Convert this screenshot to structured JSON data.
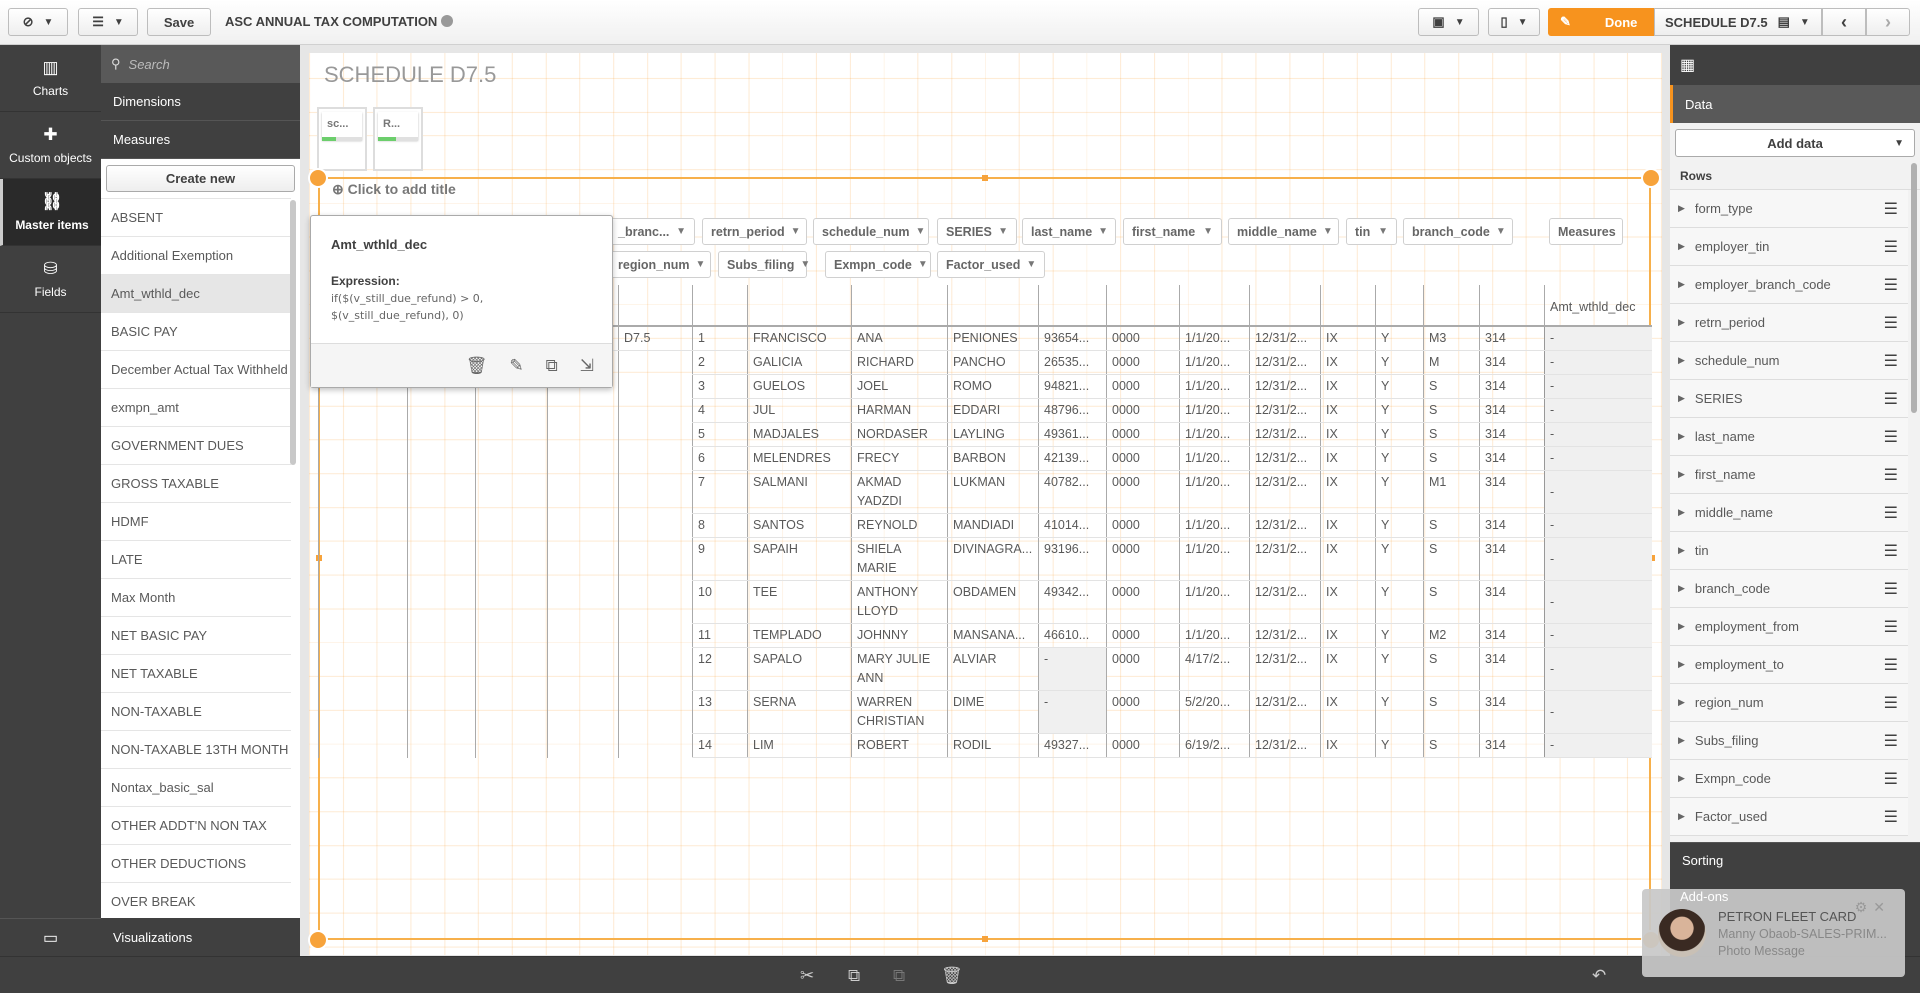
{
  "topbar": {
    "save_label": "Save",
    "app_title": "ASC ANNUAL TAX COMPUTATION",
    "done_label": "Done",
    "sheet_name": "SCHEDULE D7.5"
  },
  "left_nav": {
    "items": [
      {
        "label": "Charts",
        "icon": "bar-chart-icon"
      },
      {
        "label": "Custom objects",
        "icon": "puzzle-icon"
      },
      {
        "label": "Master items",
        "icon": "link-icon",
        "active": true
      },
      {
        "label": "Fields",
        "icon": "database-icon"
      }
    ]
  },
  "assets": {
    "search_placeholder": "Search",
    "dimensions_label": "Dimensions",
    "measures_label": "Measures",
    "create_new_label": "Create new",
    "measures": [
      "ABSENT",
      "Additional Exemption",
      "Amt_wthld_dec",
      "BASIC PAY",
      "December Actual Tax Withheld",
      "exmpn_amt",
      "GOVERNMENT DUES",
      "GROSS TAXABLE",
      "HDMF",
      "LATE",
      "Max Month",
      "NET BASIC PAY",
      "NET TAXABLE",
      "NON-TAXABLE",
      "NON-TAXABLE 13TH MONTH",
      "Nontax_basic_sal",
      "OTHER ADDT'N NON TAX",
      "OTHER DEDUCTIONS",
      "OVER BREAK"
    ],
    "selected_measure": "Amt_wthld_dec",
    "visualizations_label": "Visualizations"
  },
  "sheet": {
    "title": "SCHEDULE D7.5",
    "thumbnails": [
      {
        "label": "sc...",
        "progress": 0.35
      },
      {
        "label": "R...",
        "progress": 0.45
      }
    ],
    "add_title_label": "Click to add title"
  },
  "table": {
    "filter_chips_row1": [
      "_branc...",
      "retrn_period",
      "schedule_num",
      "SERIES",
      "last_name",
      "first_name",
      "middle_name",
      "tin",
      "branch_code"
    ],
    "filter_chips_row2": [
      "region_num",
      "Subs_filing",
      "Exmpn_code",
      "Factor_used"
    ],
    "measures_chip": "Measures",
    "measure_header": "Amt_wthld_dec",
    "rows": [
      [
        "D7.5",
        "1",
        "FRANCISCO",
        "ANA",
        "PENIONES",
        "93654...",
        "0000",
        "1/1/20...",
        "12/31/2...",
        "IX",
        "Y",
        "M3",
        "314",
        "-"
      ],
      [
        "",
        "2",
        "GALICIA",
        "RICHARD",
        "PANCHO",
        "26535...",
        "0000",
        "1/1/20...",
        "12/31/2...",
        "IX",
        "Y",
        "M",
        "314",
        "-"
      ],
      [
        "",
        "3",
        "GUELOS",
        "JOEL",
        "ROMO",
        "94821...",
        "0000",
        "1/1/20...",
        "12/31/2...",
        "IX",
        "Y",
        "S",
        "314",
        "-"
      ],
      [
        "",
        "4",
        "JUL",
        "HARMAN",
        "EDDARI",
        "48796...",
        "0000",
        "1/1/20...",
        "12/31/2...",
        "IX",
        "Y",
        "S",
        "314",
        "-"
      ],
      [
        "",
        "5",
        "MADJALES",
        "NORDASER",
        "LAYLING",
        "49361...",
        "0000",
        "1/1/20...",
        "12/31/2...",
        "IX",
        "Y",
        "S",
        "314",
        "-"
      ],
      [
        "",
        "6",
        "MELENDRES",
        "FRECY",
        "BARBON",
        "42139...",
        "0000",
        "1/1/20...",
        "12/31/2...",
        "IX",
        "Y",
        "S",
        "314",
        "-"
      ],
      [
        "",
        "7",
        "SALMANI",
        "AKMAD YADZDI",
        "LUKMAN",
        "40782...",
        "0000",
        "1/1/20...",
        "12/31/2...",
        "IX",
        "Y",
        "M1",
        "314",
        "-"
      ],
      [
        "",
        "8",
        "SANTOS",
        "REYNOLD",
        "MANDIADI",
        "41014...",
        "0000",
        "1/1/20...",
        "12/31/2...",
        "IX",
        "Y",
        "S",
        "314",
        "-"
      ],
      [
        "",
        "9",
        "SAPAIH",
        "SHIELA MARIE",
        "DIVINAGRA...",
        "93196...",
        "0000",
        "1/1/20...",
        "12/31/2...",
        "IX",
        "Y",
        "S",
        "314",
        "-"
      ],
      [
        "",
        "10",
        "TEE",
        "ANTHONY LLOYD",
        "OBDAMEN",
        "49342...",
        "0000",
        "1/1/20...",
        "12/31/2...",
        "IX",
        "Y",
        "S",
        "314",
        "-"
      ],
      [
        "",
        "11",
        "TEMPLADO",
        "JOHNNY",
        "MANSANA...",
        "46610...",
        "0000",
        "1/1/20...",
        "12/31/2...",
        "IX",
        "Y",
        "M2",
        "314",
        "-"
      ],
      [
        "",
        "12",
        "SAPALO",
        "MARY JULIE ANN",
        "ALVIAR",
        "-",
        "0000",
        "4/17/2...",
        "12/31/2...",
        "IX",
        "Y",
        "S",
        "314",
        "-"
      ],
      [
        "",
        "13",
        "SERNA",
        "WARREN CHRISTIAN",
        "DIME",
        "-",
        "0000",
        "5/2/20...",
        "12/31/2...",
        "IX",
        "Y",
        "S",
        "314",
        "-"
      ],
      [
        "",
        "14",
        "LIM",
        "ROBERT",
        "RODIL",
        "49327...",
        "0000",
        "6/19/2...",
        "12/31/2...",
        "IX",
        "Y",
        "S",
        "314",
        "-"
      ]
    ]
  },
  "tooltip": {
    "title": "Amt_wthld_dec",
    "expression_label": "Expression:",
    "expression_line1": "if($(v_still_due_refund) > 0,",
    "expression_line2": "$(v_still_due_refund), 0)"
  },
  "right_panel": {
    "data_tab": "Data",
    "add_data_label": "Add data",
    "rows_label": "Rows",
    "fields": [
      "form_type",
      "employer_tin",
      "employer_branch_code",
      "retrn_period",
      "schedule_num",
      "SERIES",
      "last_name",
      "first_name",
      "middle_name",
      "tin",
      "branch_code",
      "employment_from",
      "employment_to",
      "region_num",
      "Subs_filing",
      "Exmpn_code",
      "Factor_used"
    ],
    "sorting_label": "Sorting",
    "addons_label": "Add-ons"
  },
  "notification": {
    "title": "PETRON FLEET CARD",
    "sender": "Manny Obaob-SALES-PRIM...",
    "message": "Photo Message"
  },
  "colors": {
    "accent": "#f7931e",
    "panel_dark": "#404040",
    "selection": "#f7b04b"
  }
}
